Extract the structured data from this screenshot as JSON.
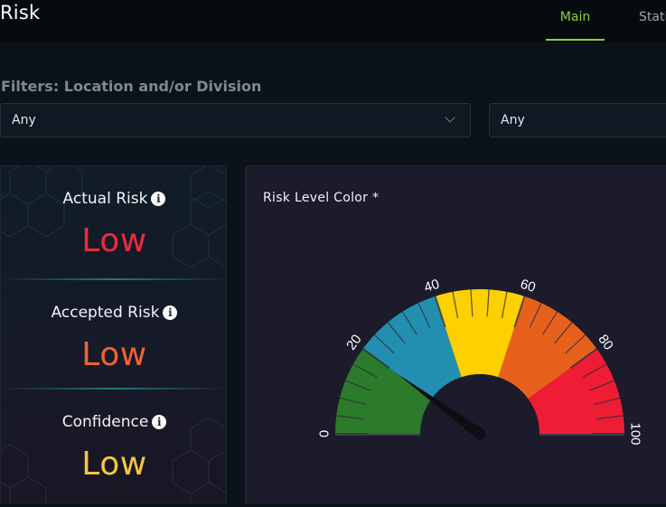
{
  "header": {
    "title": "Risk",
    "tabs": [
      {
        "label": "Main",
        "active": true
      },
      {
        "label": "Statistics",
        "active": false
      }
    ],
    "accent": "#8fce3a"
  },
  "filters": {
    "label": "Filters: Location and/or Division",
    "location": {
      "value": "Any"
    },
    "division": {
      "value": "Any"
    }
  },
  "metrics": [
    {
      "label": "Actual Risk",
      "value": "Low",
      "color": "#ee2a3d",
      "icon": "info-icon"
    },
    {
      "label": "Accepted Risk",
      "value": "Low",
      "color": "#ef6331",
      "icon": "info-icon"
    },
    {
      "label": "Confidence",
      "value": "Low",
      "color": "#f6c640",
      "icon": "info-icon"
    }
  ],
  "gauge": {
    "title": "Risk Level Color *",
    "min": 0,
    "max": 100,
    "value": 20,
    "tick_labels": [
      "0",
      "20",
      "40",
      "60",
      "80",
      "100"
    ],
    "bands": [
      {
        "from": 0,
        "to": 20,
        "color": "#2b7b2a"
      },
      {
        "from": 20,
        "to": 40,
        "color": "#238fb0"
      },
      {
        "from": 40,
        "to": 60,
        "color": "#fdd000"
      },
      {
        "from": 60,
        "to": 80,
        "color": "#e8611c"
      },
      {
        "from": 80,
        "to": 100,
        "color": "#ee1c35"
      }
    ]
  }
}
